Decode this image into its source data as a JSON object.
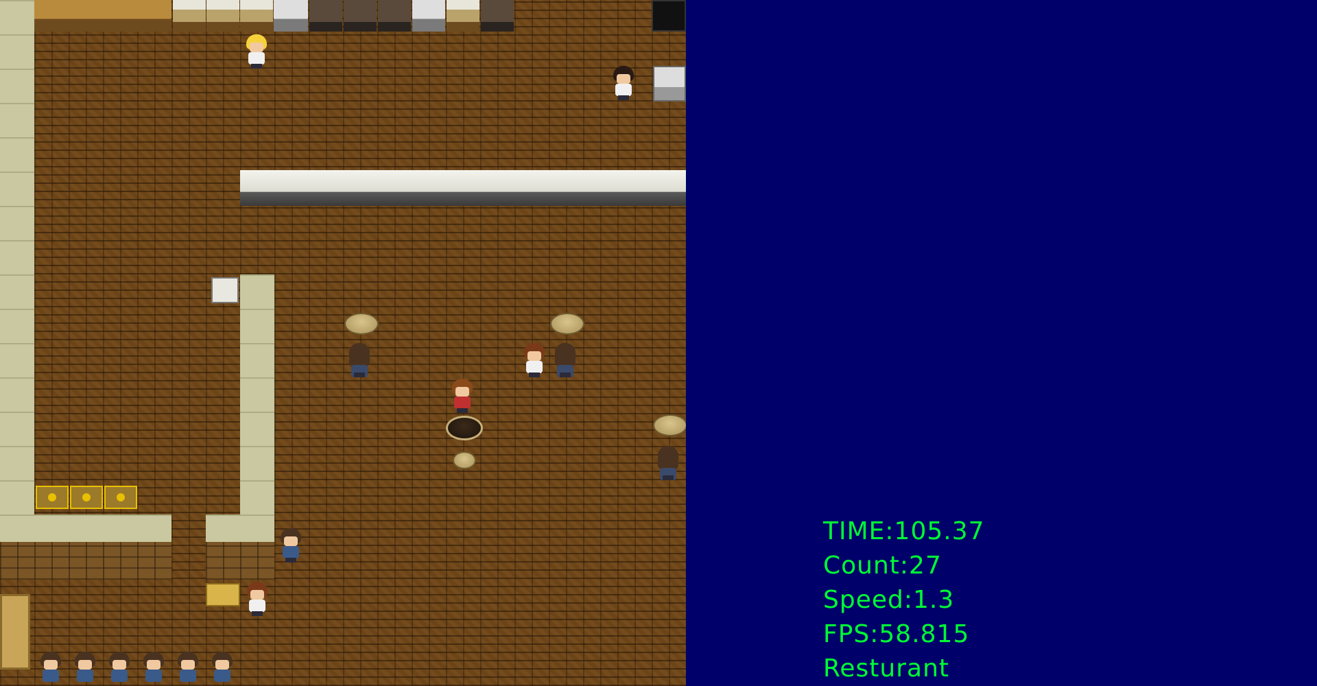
{
  "hud": {
    "time_label": "TIME:105.37",
    "count_label": "Count:27",
    "speed_label": "Speed:1.3",
    "fps_label": "FPS:58.815",
    "scene_label": "Resturant"
  },
  "colors": {
    "panel_background": "#00006b",
    "hud_text": "#00ff33",
    "floor": "#6b4418"
  },
  "scene": {
    "characters": [
      {
        "name": "chef",
        "hair": "blonde"
      },
      {
        "name": "waiter",
        "hair": "dark"
      },
      {
        "name": "customer",
        "hair": "brown"
      },
      {
        "name": "player",
        "hair": "brown"
      }
    ],
    "queue_length": 6
  }
}
